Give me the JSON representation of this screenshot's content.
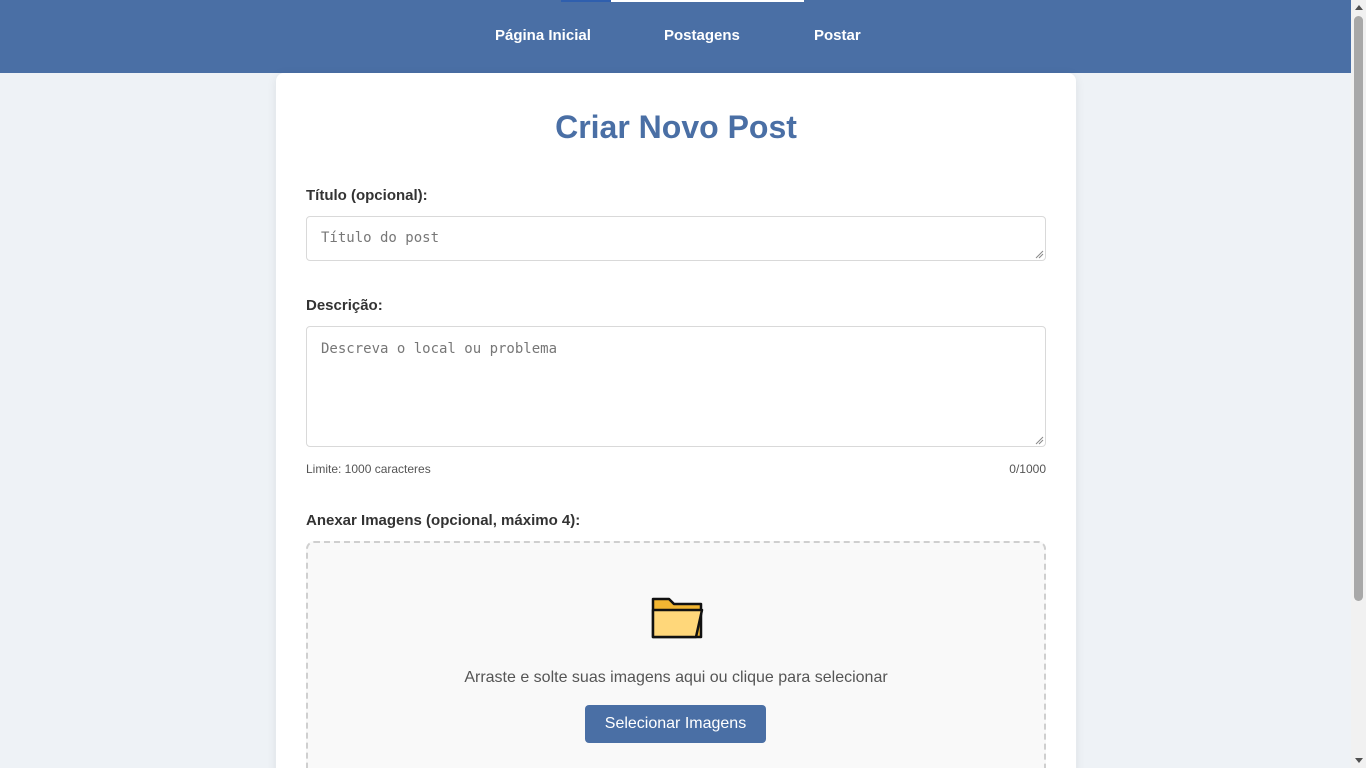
{
  "nav": {
    "items": [
      {
        "label": "Página Inicial"
      },
      {
        "label": "Postagens"
      },
      {
        "label": "Postar"
      }
    ]
  },
  "form": {
    "heading": "Criar Novo Post",
    "title_label": "Título (opcional):",
    "title_placeholder": "Título do post",
    "title_value": "",
    "description_label": "Descrição:",
    "description_placeholder": "Descreva o local ou problema",
    "description_value": "",
    "limit_text": "Limite: 1000 caracteres",
    "counter_text": "0/1000",
    "attach_label": "Anexar Imagens (opcional, máximo 4):",
    "dropzone_text": "Arraste e solte suas imagens aqui ou clique para selecionar",
    "select_button_label": "Selecionar Imagens"
  },
  "icons": {
    "dropzone_icon": "folder-icon"
  },
  "colors": {
    "header_bg": "#4a6fa5",
    "accent": "#4a6fa5",
    "page_bg": "#eef2f6",
    "card_bg": "#ffffff"
  }
}
